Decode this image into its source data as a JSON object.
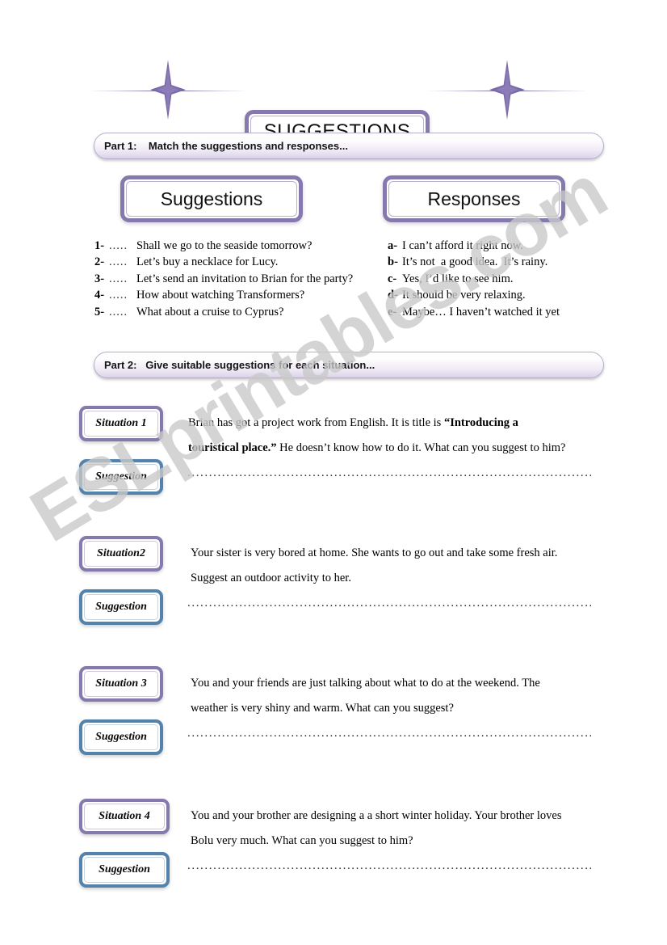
{
  "document": {
    "title": "SUGGESTIONS",
    "watermark": "ESLprintables.com"
  },
  "part1": {
    "banner": "Part 1:    Match the suggestions and responses...",
    "suggestions_heading": "Suggestions",
    "responses_heading": "Responses",
    "suggestions": [
      {
        "marker": "1-",
        "blank": ".....",
        "text": "Shall we go to the seaside tomorrow?"
      },
      {
        "marker": "2-",
        "blank": ".....",
        "text": "Let’s buy a necklace for Lucy."
      },
      {
        "marker": "3-",
        "blank": ".....",
        "text": "Let’s send an invitation to Brian for the party?"
      },
      {
        "marker": "4-",
        "blank": ".....",
        "text": "How about watching Transformers?"
      },
      {
        "marker": "5-",
        "blank": ".....",
        "text": "What about a cruise to Cyprus?"
      }
    ],
    "responses": [
      {
        "marker": "a-",
        "text": "I can’t afford it right now."
      },
      {
        "marker": "b-",
        "text": "It’s not  a good idea.  It’s rainy."
      },
      {
        "marker": "c-",
        "text": "Yes, I’d like to see him."
      },
      {
        "marker": "d-",
        "text": "It should be very relaxing."
      },
      {
        "marker": "e-",
        "text": "Maybe… I haven’t watched it yet"
      }
    ]
  },
  "part2": {
    "banner": "Part 2:   Give suitable suggestions for each situation...",
    "suggestion_tag": "Suggestion",
    "dotted_line": "..................................................................................................",
    "situations": [
      {
        "tag": "Situation 1",
        "line1_pre": "Brian has got a project work from English. It is title is ",
        "line1_bold": "“Introducing a",
        "line2_bold": "touristical place.”",
        "line2_post": " He doesn’t know how to do it. What can you suggest to him?"
      },
      {
        "tag": "Situation2",
        "line1_pre": "Your sister is very bored at home. She wants to go out and take some fresh air.",
        "line1_bold": "",
        "line2_bold": "",
        "line2_post": "Suggest an outdoor activity to her."
      },
      {
        "tag": "Situation 3",
        "line1_pre": "You and your friends are just talking about what to do at the weekend. The",
        "line1_bold": "",
        "line2_bold": "",
        "line2_post": "weather is very shiny and warm. What can you suggest?"
      },
      {
        "tag": "Situation 4",
        "line1_pre": "You and your brother are designing a a short winter holiday. Your brother loves",
        "line1_bold": "",
        "line2_bold": "",
        "line2_post": " Bolu very much. What can you suggest to him?"
      }
    ]
  },
  "colors": {
    "purple": "#8579ad",
    "blue": "#5382ac",
    "banner_fill": "#ded5ea",
    "watermark_gray": "#c9c9c9"
  }
}
